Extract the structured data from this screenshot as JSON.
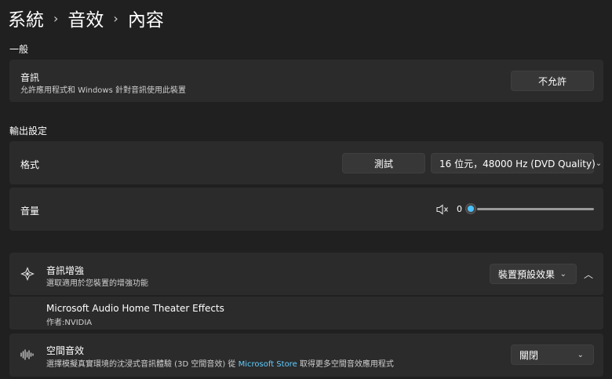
{
  "breadcrumb": {
    "items": [
      "系統",
      "音效",
      "內容"
    ],
    "separator": "›"
  },
  "sections": {
    "general": "一般",
    "output": "輸出設定"
  },
  "audio": {
    "title": "音訊",
    "subtitle": "允許應用程式和 Windows 針對音訊使用此裝置",
    "button": "不允許"
  },
  "format": {
    "label": "格式",
    "test_button": "測試",
    "selected": "16 位元，48000 Hz (DVD Quality)"
  },
  "volume": {
    "label": "音量",
    "value": "0",
    "muted_icon": "speaker-muted-icon"
  },
  "enhancement": {
    "title": "音訊增強",
    "subtitle": "選取適用於您裝置的增強功能",
    "selected": "裝置預設效果",
    "icon": "sparkle-icon"
  },
  "effect": {
    "name": "Microsoft Audio Home Theater Effects",
    "author": "作者:NVIDIA"
  },
  "spatial": {
    "title": "空間音效",
    "subtitle_prefix": "選擇模擬真實環境的沈浸式音訊體驗 (3D 空間音效)",
    "subtitle_from": "從",
    "store_link": "Microsoft Store",
    "subtitle_suffix": "取得更多空間音效應用程式",
    "selected": "關閉",
    "icon": "sound-wave-icon"
  },
  "colors": {
    "background": "#202020",
    "card": "#2b2b2b",
    "accent": "#4cc2ff",
    "link": "#60cdff"
  }
}
